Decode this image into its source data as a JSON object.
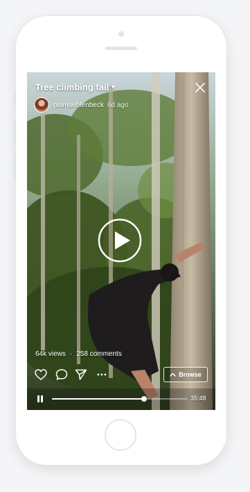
{
  "video": {
    "title": "Tree climbing fail",
    "author": "piamuehlenbeck",
    "posted": "6d ago",
    "views": "64k views",
    "separator": "·",
    "comments": "258 comments",
    "duration": "35:48",
    "progress": 0.68
  },
  "controls": {
    "browse_label": "Browse"
  },
  "colors": {
    "overlay_text": "#ffffff",
    "foliage": "#35461f",
    "phone_body": "#ffffff"
  },
  "icons": {
    "title_dropdown": "chevron-down-icon",
    "close": "close-icon",
    "play": "play-icon",
    "like": "heart-icon",
    "comment": "comment-icon",
    "share": "send-icon",
    "more": "more-icon",
    "browse": "chevron-up-icon",
    "pause": "pause-icon"
  }
}
